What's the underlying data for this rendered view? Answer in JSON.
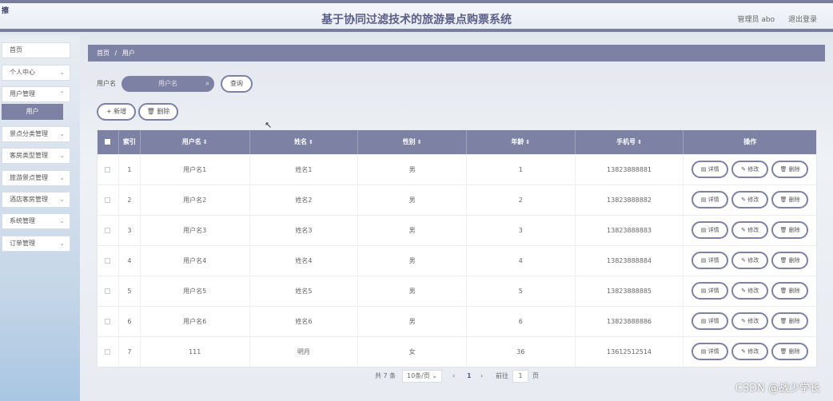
{
  "header": {
    "corner_logo": "擦",
    "title": "基于协同过滤技术的旅游景点购票系统",
    "admin": "管理员 abo",
    "logout": "退出登录"
  },
  "sidebar": {
    "items": [
      {
        "label": "首页"
      },
      {
        "label": "个人中心"
      },
      {
        "label": "用户管理"
      },
      {
        "label": "景点分类管理"
      },
      {
        "label": "客房类型管理"
      },
      {
        "label": "旅游景点管理"
      },
      {
        "label": "酒店客房管理"
      },
      {
        "label": "系统管理"
      },
      {
        "label": "订单管理"
      }
    ],
    "active_sub": "用户"
  },
  "breadcrumb": {
    "home": "首页",
    "sep": "/",
    "current": "用户"
  },
  "search": {
    "label": "用户名",
    "placeholder": "用户名",
    "query_btn": "查询"
  },
  "actions": {
    "add": "+ 新增",
    "delete": "删除"
  },
  "table": {
    "columns": [
      "索引",
      "用户名",
      "姓名",
      "性别",
      "年龄",
      "手机号",
      "操作"
    ],
    "rows": [
      {
        "idx": "1",
        "username": "用户名1",
        "name": "姓名1",
        "gender": "男",
        "age": "1",
        "phone": "13823888881"
      },
      {
        "idx": "2",
        "username": "用户名2",
        "name": "姓名2",
        "gender": "男",
        "age": "2",
        "phone": "13823888882"
      },
      {
        "idx": "3",
        "username": "用户名3",
        "name": "姓名3",
        "gender": "男",
        "age": "3",
        "phone": "13823888883"
      },
      {
        "idx": "4",
        "username": "用户名4",
        "name": "姓名4",
        "gender": "男",
        "age": "4",
        "phone": "13823888884"
      },
      {
        "idx": "5",
        "username": "用户名5",
        "name": "姓名5",
        "gender": "男",
        "age": "5",
        "phone": "13823888885"
      },
      {
        "idx": "6",
        "username": "用户名6",
        "name": "姓名6",
        "gender": "男",
        "age": "6",
        "phone": "13823888886"
      },
      {
        "idx": "7",
        "username": "111",
        "name": "明月",
        "gender": "女",
        "age": "36",
        "phone": "13612512514"
      }
    ],
    "row_actions": {
      "detail": "详情",
      "edit": "修改",
      "delete": "删除"
    }
  },
  "pagination": {
    "total": "共 7 条",
    "page_size": "10条/页",
    "current_page": "1",
    "goto_label": "前往",
    "goto_value": "1",
    "page_unit": "页"
  },
  "watermark": "CSDN @战少学长",
  "colors": {
    "accent": "#7d81a3",
    "title": "#5c5f88"
  }
}
